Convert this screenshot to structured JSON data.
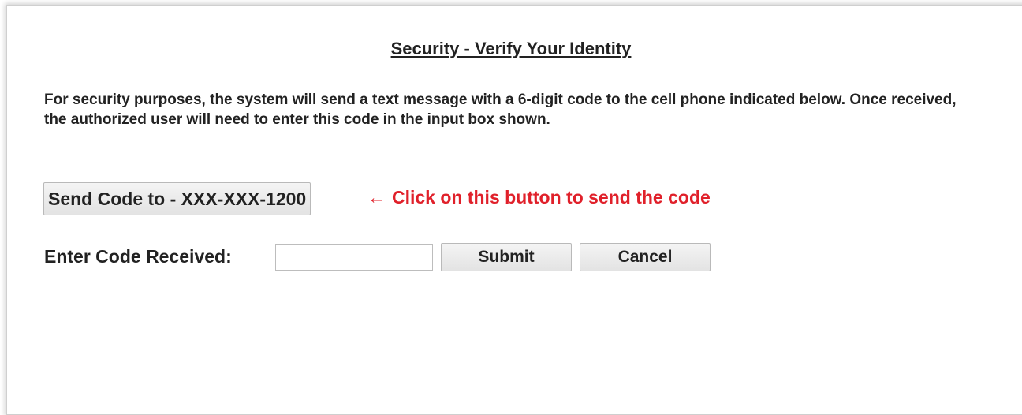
{
  "page": {
    "title": "Security - Verify Your Identity",
    "intro": "For security purposes, the system will send a text message with a 6-digit code to the cell phone indicated below. Once received, the authorized user will need to enter this code in the input box shown."
  },
  "send_code": {
    "button_label": "Send Code to - XXX-XXX-1200",
    "hint_arrow": "←",
    "hint_text": "Click on this button to send the code",
    "hint_color": "#e0202a"
  },
  "verify": {
    "label": "Enter Code Received:",
    "input_value": "",
    "input_placeholder": "",
    "submit_label": "Submit",
    "cancel_label": "Cancel"
  }
}
